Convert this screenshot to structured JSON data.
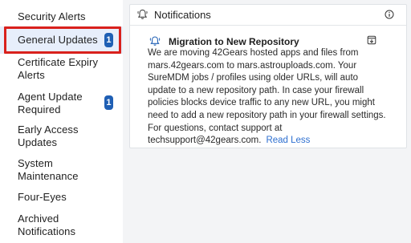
{
  "sidebar": {
    "items": [
      {
        "label_lines": [
          "Security Alerts"
        ],
        "badge": ""
      },
      {
        "label_lines": [
          "General Updates"
        ],
        "badge": "1",
        "selected": true
      },
      {
        "label_lines": [
          "Certificate Expiry",
          "Alerts"
        ],
        "badge": ""
      },
      {
        "label_lines": [
          "Agent Update",
          "Required"
        ],
        "badge": "1"
      },
      {
        "label_lines": [
          "Early Access",
          "Updates"
        ],
        "badge": ""
      },
      {
        "label_lines": [
          "System",
          "Maintenance"
        ],
        "badge": ""
      },
      {
        "label_lines": [
          "Four-Eyes"
        ],
        "badge": ""
      },
      {
        "label_lines": [
          "Archived",
          "Notifications"
        ],
        "badge": ""
      }
    ]
  },
  "panel": {
    "header_title": "Notifications",
    "header_icon": "bell-icon",
    "info_icon": "info-icon",
    "notification": {
      "icon": "bell-ring-icon",
      "title": "Migration to New Repository",
      "action_icon": "archive-download-icon",
      "body": "We are moving 42Gears hosted apps and files from mars.42gears.com to mars.astrouploads.com. Your SureMDM jobs / profiles using older URLs, will auto update to a new repository path. In case your firewall policies blocks device traffic to any new URL, you might need to add a new repository path in your firewall settings. For questions, contact support at techsupport@42gears.com.",
      "link_label": "Read Less"
    }
  },
  "colors": {
    "accent": "#1f5fb4",
    "link": "#2d6fd0",
    "highlight": "#d9211c",
    "selected_bg": "#e7eefb"
  }
}
